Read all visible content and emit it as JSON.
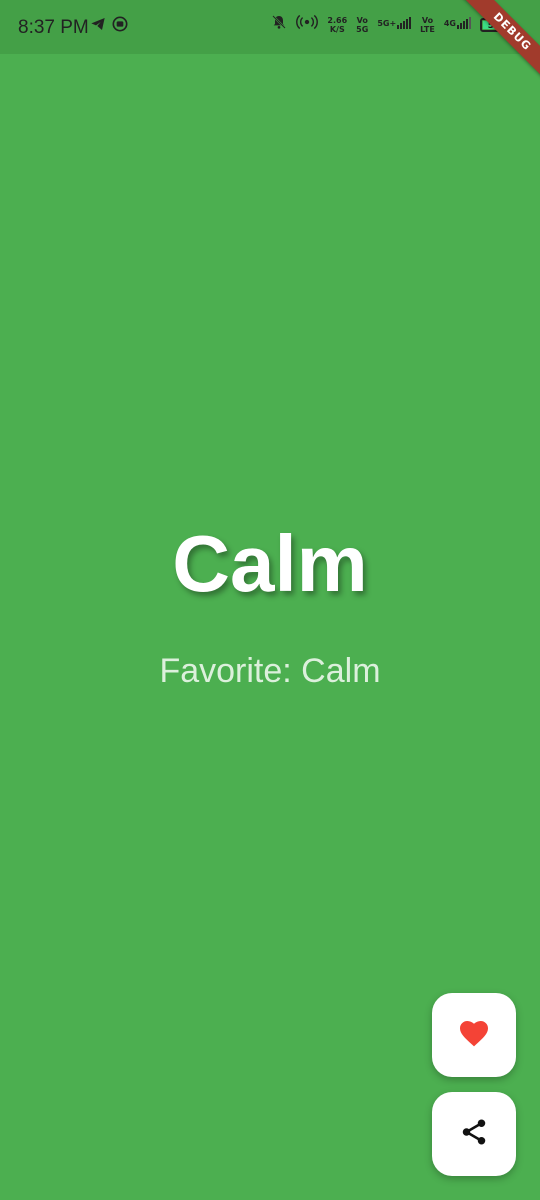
{
  "status_bar": {
    "time": "8:37 PM",
    "net_speed": "2.66",
    "net_speed_unit": "K/S",
    "sim1_label_top": "Vo",
    "sim1_label_bottom": "5G",
    "sim1_network": "5G+",
    "sim2_label_top": "Vo",
    "sim2_label_bottom": "LTE",
    "sim2_network": "4G",
    "battery_level": "51"
  },
  "debug_banner": "DEBUG",
  "main": {
    "mood_title": "Calm",
    "favorite_text": "Favorite: Calm"
  },
  "colors": {
    "background": "#4caf50",
    "heart": "#f44336"
  },
  "icons": [
    "telegram-icon",
    "youtube-icon",
    "bell-off-icon",
    "hotspot-icon",
    "signal-icon",
    "battery-icon",
    "heart-icon",
    "share-icon"
  ]
}
